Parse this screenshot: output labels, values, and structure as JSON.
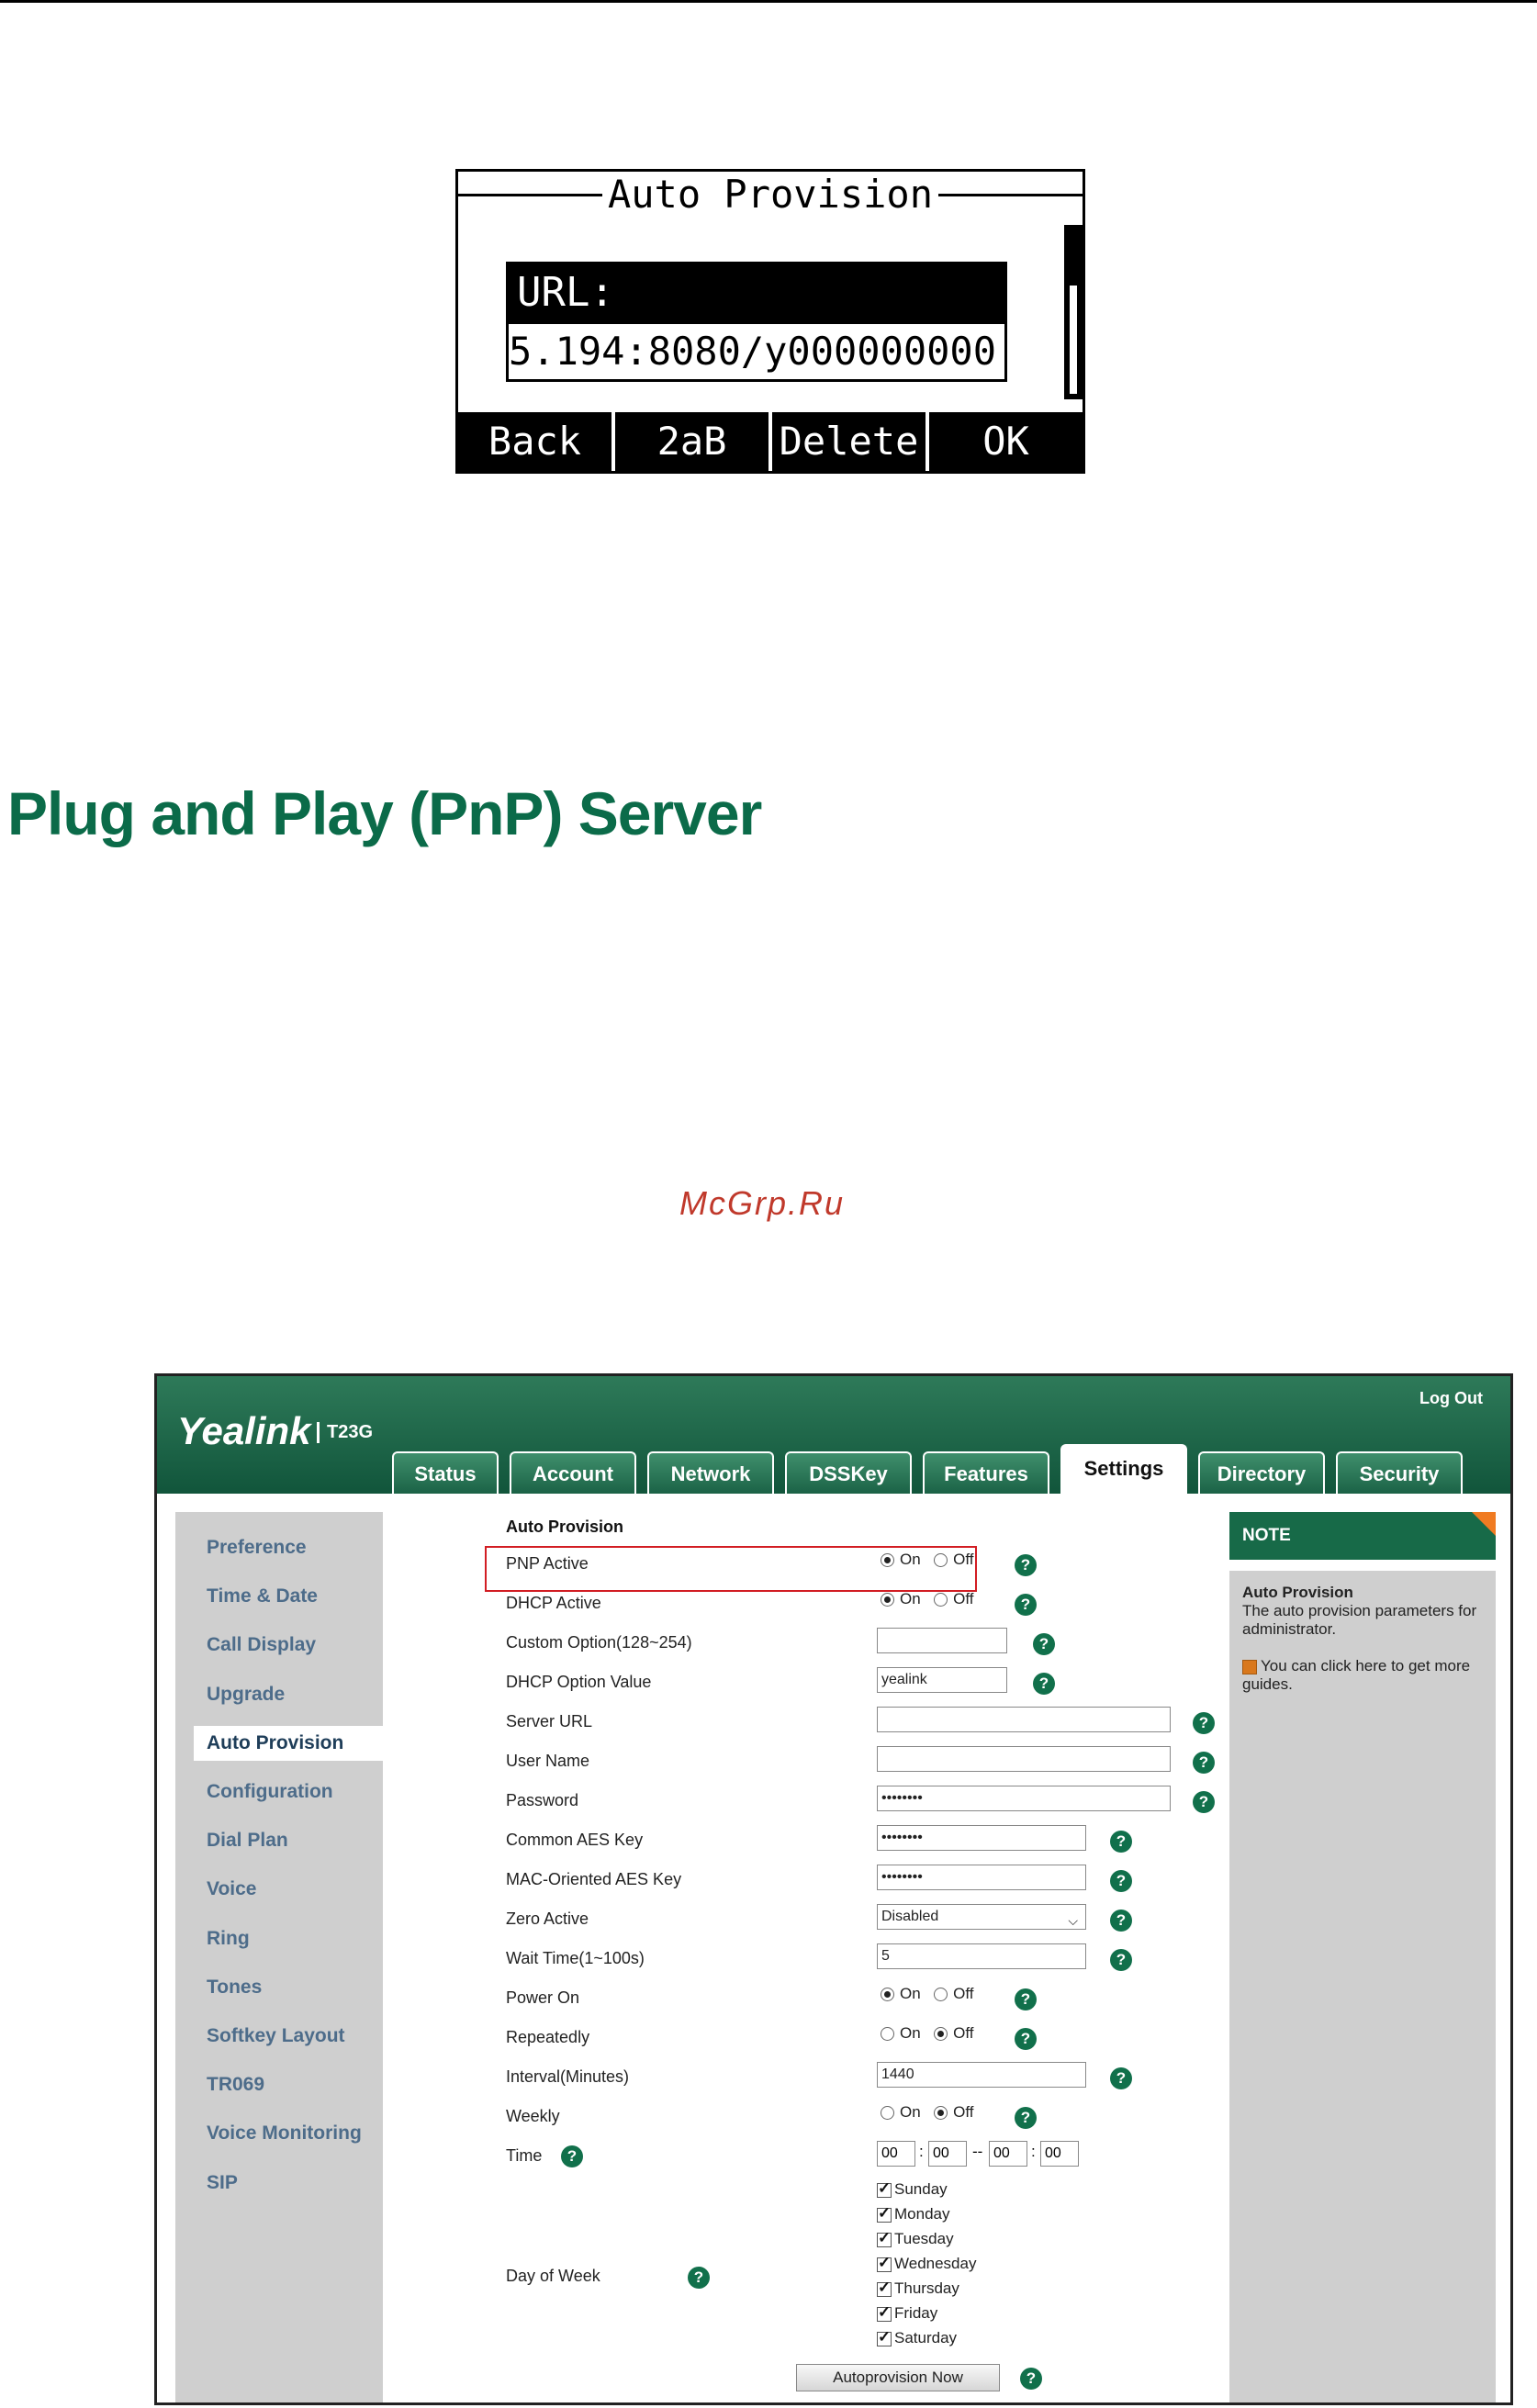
{
  "lcd": {
    "title": "Auto Provision",
    "field_label": "URL:",
    "field_value": "5.194:8080/y000000000",
    "softkeys": [
      "Back",
      "2aB",
      "Delete",
      "OK"
    ]
  },
  "heading": "Plug and Play (PnP) Server",
  "watermark": "McGrp.Ru",
  "web": {
    "logo": "Yealink",
    "model": "T23G",
    "logout": "Log Out",
    "tabs": [
      "Status",
      "Account",
      "Network",
      "DSSKey",
      "Features",
      "Settings",
      "Directory",
      "Security"
    ],
    "active_tab": "Settings",
    "sidebar": [
      "Preference",
      "Time & Date",
      "Call Display",
      "Upgrade",
      "Auto Provision",
      "Configuration",
      "Dial Plan",
      "Voice",
      "Ring",
      "Tones",
      "Softkey Layout",
      "TR069",
      "Voice Monitoring",
      "SIP"
    ],
    "active_sidebar": "Auto Provision",
    "section_title": "Auto Provision",
    "radio_on": "On",
    "radio_off": "Off",
    "fields": {
      "pnp_active": {
        "label": "PNP Active",
        "value": "On"
      },
      "dhcp_active": {
        "label": "DHCP Active",
        "value": "On"
      },
      "custom_option": {
        "label": "Custom Option(128~254)",
        "value": ""
      },
      "dhcp_option_value": {
        "label": "DHCP Option Value",
        "value": "yealink"
      },
      "server_url": {
        "label": "Server URL",
        "value": ""
      },
      "user_name": {
        "label": "User Name",
        "value": ""
      },
      "password": {
        "label": "Password",
        "value": "••••••••"
      },
      "common_aes": {
        "label": "Common AES Key",
        "value": "••••••••"
      },
      "mac_aes": {
        "label": "MAC-Oriented AES Key",
        "value": "••••••••"
      },
      "zero_active": {
        "label": "Zero Active",
        "value": "Disabled"
      },
      "wait_time": {
        "label": "Wait Time(1~100s)",
        "value": "5"
      },
      "power_on": {
        "label": "Power On",
        "value": "On"
      },
      "repeatedly": {
        "label": "Repeatedly",
        "value": "Off"
      },
      "interval": {
        "label": "Interval(Minutes)",
        "value": "1440"
      },
      "weekly": {
        "label": "Weekly",
        "value": "Off"
      },
      "time": {
        "label": "Time",
        "values": [
          "00",
          "00",
          "00",
          "00"
        ]
      },
      "day_of_week": {
        "label": "Day of Week",
        "days": [
          "Sunday",
          "Monday",
          "Tuesday",
          "Wednesday",
          "Thursday",
          "Friday",
          "Saturday"
        ]
      }
    },
    "autoprovision_button": "Autoprovision Now",
    "note": {
      "title": "NOTE",
      "heading": "Auto Provision",
      "text": "The auto provision parameters for administrator.",
      "guide": "You can click here to get more guides."
    },
    "colors": {
      "header": "#11553b",
      "accent": "#0b6b49",
      "highlight": "#d21d23",
      "note_corner": "#f07b22"
    }
  }
}
